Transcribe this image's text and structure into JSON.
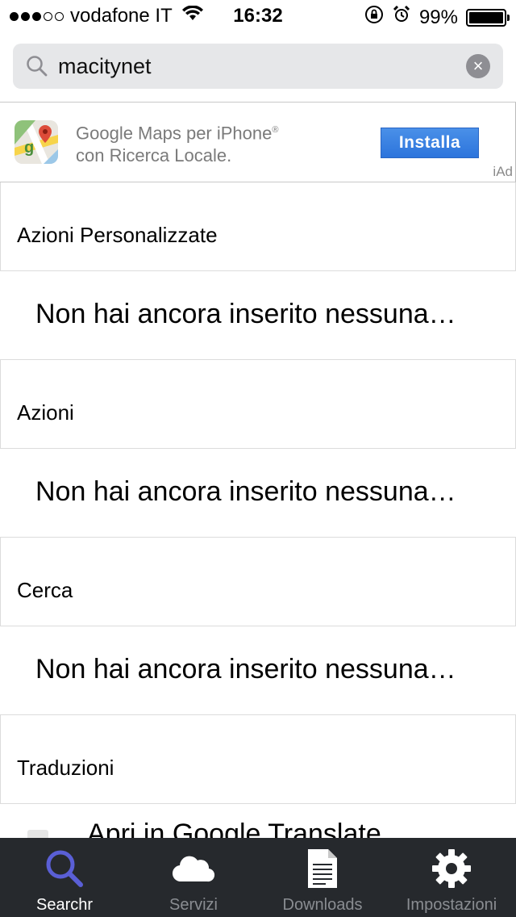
{
  "status_bar": {
    "carrier": "vodafone IT",
    "time": "16:32",
    "battery": "99%",
    "battery_level": 0.99,
    "signal_bars": 3,
    "signal_total": 5
  },
  "search": {
    "value": "macitynet",
    "placeholder": ""
  },
  "ad": {
    "line1": "Google Maps per iPhone",
    "line1_mark": "®",
    "line2": "con Ricerca Locale.",
    "button_label": "Installa",
    "badge": "iAd"
  },
  "sections": [
    {
      "header": "Azioni Personalizzate",
      "row": "Non hai ancora inserito nessuna…"
    },
    {
      "header": "Azioni",
      "row": "Non hai ancora inserito nessuna…"
    },
    {
      "header": "Cerca",
      "row": "Non hai ancora inserito nessuna…"
    },
    {
      "header": "Traduzioni",
      "action": "Apri in Google Translate"
    }
  ],
  "tabs": [
    {
      "label": "Searchr",
      "icon": "magnifier-icon",
      "active": true
    },
    {
      "label": "Servizi",
      "icon": "cloud-icon",
      "active": false
    },
    {
      "label": "Downloads",
      "icon": "document-icon",
      "active": false
    },
    {
      "label": "Impostazioni",
      "icon": "gear-icon",
      "active": false
    }
  ],
  "colors": {
    "tab_bar_bg": "#26292d",
    "tab_active_icon": "#5a5fd6",
    "tab_inactive": "#8a8d92",
    "ad_button": "#2c74dc",
    "search_bg": "#e6e7e9"
  }
}
